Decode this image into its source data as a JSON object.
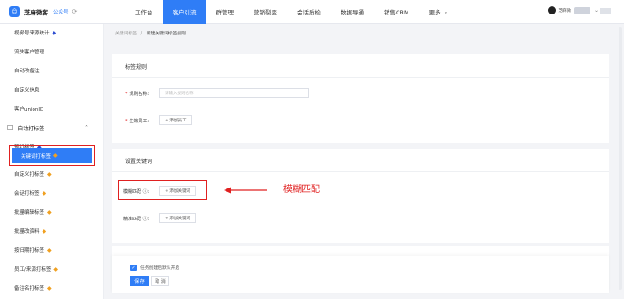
{
  "topbar": {
    "app_name": "芝麻微客",
    "account_label": "公众号",
    "nav": [
      "工作台",
      "客户引流",
      "群管理",
      "营销裂变",
      "会话质检",
      "数据导通",
      "销售CRM",
      "更多"
    ],
    "active_nav": "客户引流",
    "more_caret": "⌄",
    "user_name": "芝麻微"
  },
  "sidebar": {
    "items": [
      {
        "label": "视频号来源统计",
        "gem": "blue"
      },
      {
        "label": "流失客户管理"
      },
      {
        "label": "自动改备注"
      },
      {
        "label": "自定义信息"
      },
      {
        "label": "客户unionID"
      },
      {
        "label": "自动打标签",
        "group": true
      },
      {
        "label": "预打标签",
        "gem": "blue"
      },
      {
        "label": "关键词打标签",
        "gem": "gold",
        "selected": true
      },
      {
        "label": "自定义打标签",
        "gem": "gold"
      },
      {
        "label": "会话打标签",
        "gem": "gold"
      },
      {
        "label": "批量编辑标签",
        "gem": "gold"
      },
      {
        "label": "批量改资料",
        "gem": "gold"
      },
      {
        "label": "按日期打标签",
        "gem": "gold"
      },
      {
        "label": "员工/来源打标签",
        "gem": "gold"
      },
      {
        "label": "备注名打标签",
        "gem": "gold"
      }
    ]
  },
  "breadcrumb": {
    "parent": "关键词标签",
    "sep": "/",
    "current": "新建关键词标签规则"
  },
  "rule_card": {
    "title": "标签规则",
    "name_label": "规则名称:",
    "name_placeholder": "请输入规则名称",
    "staff_label": "生效员工:",
    "staff_button": "+ 添加员工"
  },
  "keyword_card": {
    "title": "设置关键词",
    "fuzzy_label": "模糊匹配 ⓘ:",
    "fuzzy_button": "+ 添加关键词",
    "exact_label": "精准匹配 ⓘ:",
    "exact_button": "+ 添加关键词"
  },
  "annotation": "模糊匹配",
  "footer": {
    "checkbox_label": "任务创建后默认开启",
    "save": "保 存",
    "cancel": "取 消"
  },
  "colors": {
    "accent": "#2f7df6",
    "highlight": "#e02020",
    "gem_gold": "#f0a020",
    "gem_blue": "#2f4ed1"
  }
}
